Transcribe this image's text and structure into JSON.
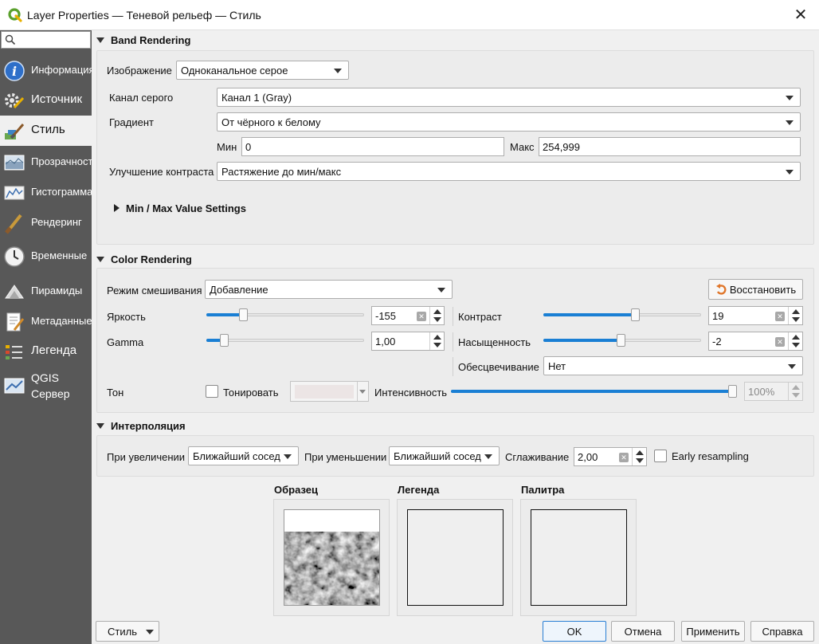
{
  "window": {
    "title": "Layer Properties — Теневой рельеф — Стиль",
    "close_icon": "close-icon"
  },
  "sidebar": {
    "search_placeholder": "",
    "items": [
      {
        "label": "Информация",
        "icon": "info-icon"
      },
      {
        "label": "Источник",
        "icon": "source-icon"
      },
      {
        "label": "Стиль",
        "icon": "style-brush-icon"
      },
      {
        "label": "Прозрачност",
        "icon": "transparency-icon"
      },
      {
        "label": "Гистограмма",
        "icon": "histogram-icon"
      },
      {
        "label": "Рендеринг",
        "icon": "rendering-icon"
      },
      {
        "label": "Временные",
        "icon": "clock-icon"
      },
      {
        "label": "Пирамиды",
        "icon": "pyramids-icon"
      },
      {
        "label": "Метаданные",
        "icon": "metadata-icon"
      },
      {
        "label": "Легенда",
        "icon": "legend-icon"
      },
      {
        "label": "QGIS",
        "label2": "Сервер",
        "icon": "qgis-server-icon"
      }
    ],
    "active_index": 2
  },
  "band": {
    "header": "Band Rendering",
    "image_label": "Изображение",
    "image_value": "Одноканальное серое",
    "gray_band_label": "Канал серого",
    "gray_band_value": "Канал 1 (Gray)",
    "gradient_label": "Градиент",
    "gradient_value": "От чёрного к белому",
    "min_label": "Мин",
    "min_value": "0",
    "max_label": "Макс",
    "max_value": "254,999",
    "contrast_label": "Улучшение контраста",
    "contrast_value": "Растяжение до мин/макс",
    "minmax_label": "Min / Max Value Settings"
  },
  "color": {
    "header": "Color Rendering",
    "blend_label": "Режим смешивания",
    "blend_value": "Добавление",
    "reset_label": "Восстановить",
    "brightness_label": "Яркость",
    "brightness_value": "-155",
    "brightness_fraction": 0.22,
    "contrast_label": "Контраст",
    "contrast_value": "19",
    "contrast_fraction": 0.59,
    "gamma_label": "Gamma",
    "gamma_value": "1,00",
    "gamma_fraction": 0.09,
    "saturation_label": "Насыщенность",
    "saturation_value": "-2",
    "saturation_fraction": 0.49,
    "grayscale_label": "Обесцвечивание",
    "grayscale_value": "Нет",
    "hue_label": "Тон",
    "colorize_label": "Тонировать",
    "colorize_checked": false,
    "colorize_color": "#ece5e5",
    "intensity_label": "Интенсивность",
    "intensity_value": "100%",
    "intensity_fraction": 1.0
  },
  "interp": {
    "header": "Интерполяция",
    "zoom_in_label": "При увеличении",
    "zoom_in_value": "Ближайший сосед",
    "zoom_out_label": "При уменьшении",
    "zoom_out_value": "Ближайший сосед",
    "oversampling_label": "Сглаживание",
    "oversampling_value": "2,00",
    "early_label": "Early resampling",
    "early_checked": false
  },
  "previews": {
    "sample_label": "Образец",
    "legend_label": "Легенда",
    "palette_label": "Палитра"
  },
  "footer": {
    "style_label": "Стиль",
    "ok_label": "OK",
    "cancel_label": "Отмена",
    "apply_label": "Применить",
    "help_label": "Справка"
  },
  "colors": {
    "accent": "#1a7fd4",
    "sidebar_bg": "#585858",
    "qgis_green": "#5aa02c"
  }
}
